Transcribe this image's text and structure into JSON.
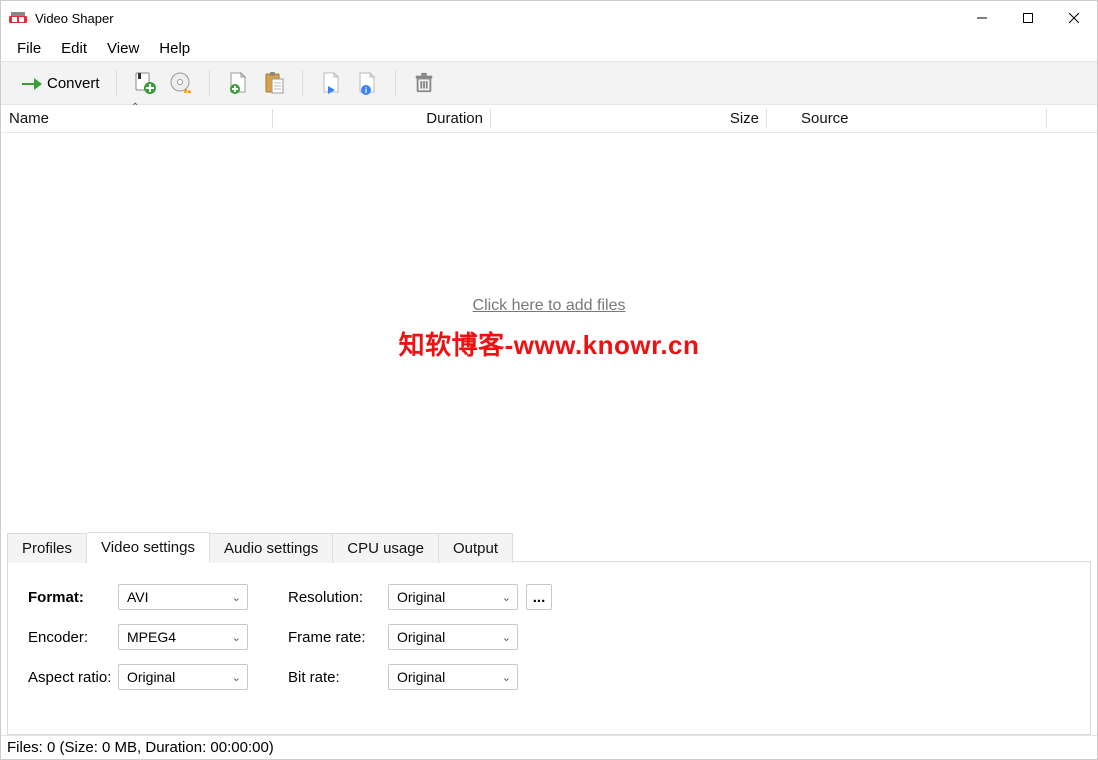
{
  "window": {
    "title": "Video Shaper"
  },
  "menu": {
    "file": "File",
    "edit": "Edit",
    "view": "View",
    "help": "Help"
  },
  "toolbar": {
    "convert_label": "Convert"
  },
  "table": {
    "col_name": "Name",
    "col_duration": "Duration",
    "col_size": "Size",
    "col_source": "Source"
  },
  "file_area": {
    "add_files_link": "Click here to add files",
    "watermark": "知软博客-www.knowr.cn"
  },
  "tabs": {
    "profiles": "Profiles",
    "video_settings": "Video settings",
    "audio_settings": "Audio settings",
    "cpu_usage": "CPU usage",
    "output": "Output"
  },
  "video_settings": {
    "format_label": "Format:",
    "format_value": "AVI",
    "encoder_label": "Encoder:",
    "encoder_value": "MPEG4",
    "aspect_label": "Aspect ratio:",
    "aspect_value": "Original",
    "resolution_label": "Resolution:",
    "resolution_value": "Original",
    "framerate_label": "Frame rate:",
    "framerate_value": "Original",
    "bitrate_label": "Bit rate:",
    "bitrate_value": "Original",
    "dots": "..."
  },
  "status": {
    "text": "Files: 0 (Size: 0 MB, Duration: 00:00:00)"
  }
}
